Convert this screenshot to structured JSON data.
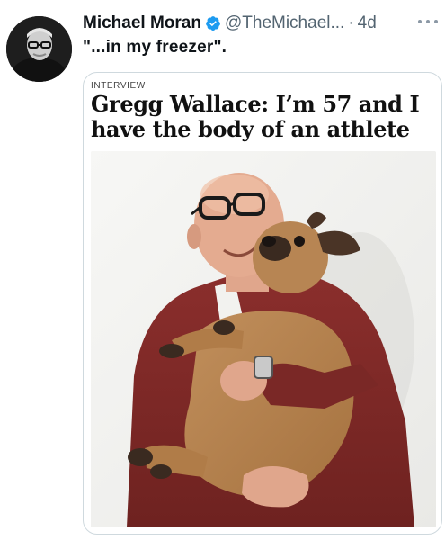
{
  "tweet": {
    "author": {
      "display_name": "Michael Moran",
      "handle": "@TheMichael...",
      "verified": true,
      "avatar_icon": "avatar-photo"
    },
    "separator": "·",
    "time": "4d",
    "more_icon": "more-horizontal-icon",
    "text": "\"...in my freezer\"."
  },
  "card": {
    "kicker": "INTERVIEW",
    "headline": "Gregg Wallace: I’m 57 and I have the body of an athlete",
    "image": "photo-man-hugging-french-bulldog"
  },
  "colors": {
    "text": "#0f1419",
    "secondary": "#536471",
    "verified": "#1d9bf0",
    "border": "#cfd9de"
  }
}
